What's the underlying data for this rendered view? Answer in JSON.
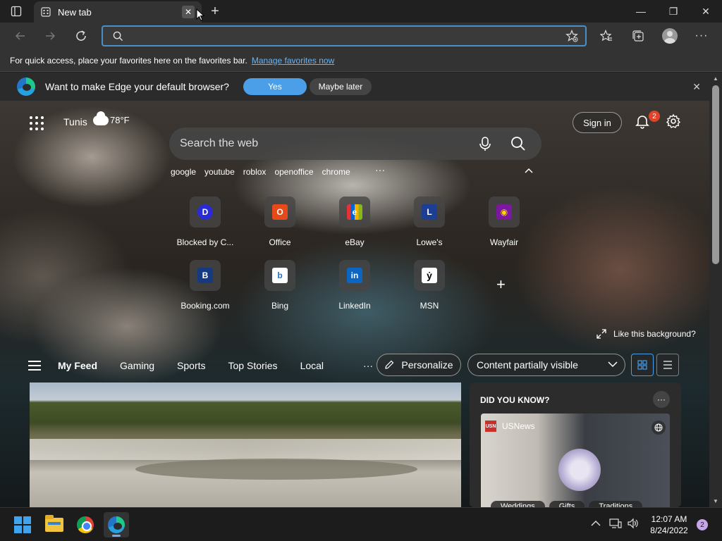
{
  "browser": {
    "tab_title": "New tab",
    "tab_close": "✕",
    "new_tab": "+",
    "address_placeholder": "",
    "minimize": "—",
    "restore": "❐",
    "close": "✕"
  },
  "favorites_bar": {
    "text": "For quick access, place your favorites here on the favorites bar.",
    "link": "Manage favorites now"
  },
  "banner": {
    "text": "Want to make Edge your default browser?",
    "yes": "Yes",
    "later": "Maybe later",
    "close": "✕"
  },
  "header": {
    "city": "Tunis",
    "temp": "78°F",
    "signin": "Sign in",
    "notifications": "2"
  },
  "search": {
    "placeholder": "Search the web",
    "quick_links": [
      "google",
      "youtube",
      "roblox",
      "openoffice",
      "chrome"
    ],
    "more": "···"
  },
  "tiles": [
    {
      "label": "Blocked by C...",
      "glyph": "D",
      "color": "#2b2bd6"
    },
    {
      "label": "Office",
      "glyph": "O",
      "color": "#e64a19"
    },
    {
      "label": "eBay",
      "glyph": "e",
      "color": "#2a8cd8"
    },
    {
      "label": "Lowe's",
      "glyph": "L",
      "color": "#1c3f94"
    },
    {
      "label": "Wayfair",
      "glyph": "◉",
      "color": "#7b189f"
    },
    {
      "label": "Booking.com",
      "glyph": "B",
      "color": "#153a82"
    },
    {
      "label": "Bing",
      "glyph": "b",
      "color": "#ffffff"
    },
    {
      "label": "LinkedIn",
      "glyph": "in",
      "color": "#0a66c2"
    },
    {
      "label": "MSN",
      "glyph": "ẏ",
      "color": "#ffffff"
    }
  ],
  "add_tile": "+",
  "like_background": "Like this background?",
  "feed": {
    "nav": [
      "My Feed",
      "Gaming",
      "Sports",
      "Top Stories",
      "Local"
    ],
    "more": "···",
    "personalize": "Personalize",
    "content_visibility": "Content partially visible"
  },
  "did_you_know": {
    "heading": "DID YOU KNOW?",
    "more": "···",
    "source": "USNews",
    "source_logo": "USN",
    "tags": [
      "Weddings",
      "Gifts",
      "Traditions"
    ]
  },
  "taskbar": {
    "time": "12:07 AM",
    "date": "8/24/2022",
    "notifications": "2"
  },
  "colors": {
    "accent": "#4a9fe8",
    "link": "#6cb4f0",
    "badge": "#e0452b"
  }
}
